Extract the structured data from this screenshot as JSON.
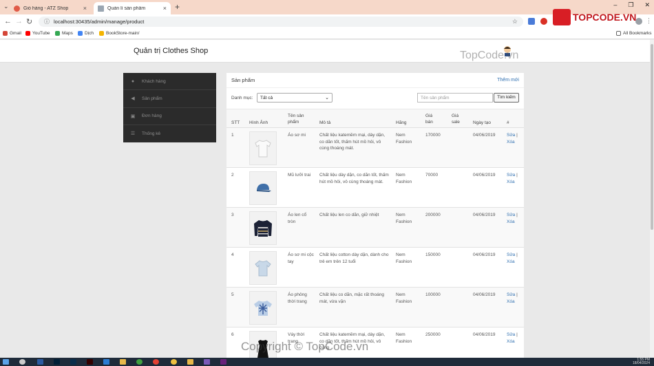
{
  "browser": {
    "tabs": [
      {
        "title": "Giỏ hàng - ATZ Shop",
        "color": "#e05a47",
        "active": false
      },
      {
        "title": "Quản lí sản phẩm",
        "color": "#9aa6b2",
        "active": true
      }
    ],
    "new_tab": "+",
    "url": "localhost:30435/admin/manage/product",
    "bookmarks": [
      {
        "label": "Gmail",
        "color": "#d44638"
      },
      {
        "label": "YouTube",
        "color": "#ff0000"
      },
      {
        "label": "Maps",
        "color": "#34a853"
      },
      {
        "label": "Dịch",
        "color": "#4285f4"
      },
      {
        "label": "BookStore-main/",
        "color": "#f4b400"
      }
    ],
    "all_bookmarks": "All Bookmarks"
  },
  "app": {
    "brand": "Quản trị Clothes Shop",
    "sidebar": [
      {
        "label": "Khách hàng",
        "icon": "user-icon"
      },
      {
        "label": "Sản phẩm",
        "icon": "megaphone-icon"
      },
      {
        "label": "Đơn hàng",
        "icon": "inbox-icon"
      },
      {
        "label": "Thống kê",
        "icon": "list-icon"
      }
    ],
    "panel_title": "Sản phẩm",
    "add_new": "Thêm mới",
    "filter_label": "Danh mục:",
    "filter_value": "Tất cả",
    "search_placeholder": "Tên sản phẩm",
    "search_button": "Tìm kiếm",
    "columns": {
      "stt": "STT",
      "image": "Hình Ảnh",
      "name": "Tên sản phẩm",
      "desc": "Mô tả",
      "brand": "Hãng",
      "price": "Giá bán",
      "sale": "Giá sale",
      "date": "Ngày tạo",
      "action": "#"
    },
    "rows": [
      {
        "stt": "1",
        "name": "Áo sơ mi",
        "desc": "Chất liệu katemềm mại, dày dặn, co dãn tốt, thấm hút mồ hôi, vô cùng thoáng mát.",
        "brand": "Nem Fashion",
        "price": "170000",
        "sale": "",
        "date": "04/06/2019",
        "img": "white-shirt",
        "edit": "Sửa",
        "sep": "|",
        "delete": "Xóa"
      },
      {
        "stt": "2",
        "name": "Mũ lưỡi trai",
        "desc": "Chất liệu dày dặn, co dãn tốt, thấm hút mồ hôi, vô cùng thoáng mát.",
        "brand": "Nem Fashion",
        "price": "70000",
        "sale": "",
        "date": "04/06/2019",
        "img": "blue-cap",
        "edit": "Sửa",
        "sep": "|",
        "delete": "Xóa"
      },
      {
        "stt": "3",
        "name": "Áo len cổ tròn",
        "desc": "Chất liệu len co dãn, giữ nhiệt",
        "brand": "Nem Fashion",
        "price": "200000",
        "sale": "",
        "date": "04/06/2019",
        "img": "striped-sweater",
        "edit": "Sửa",
        "sep": "|",
        "delete": "Xóa"
      },
      {
        "stt": "4",
        "name": "Áo sơ mi cộc tay",
        "desc": "Chất liệu cotton dày dặn, dành cho trẻ em trên 12 tuổi",
        "brand": "Nem Fashion",
        "price": "150000",
        "sale": "",
        "date": "04/06/2019",
        "img": "light-blue-shirt",
        "edit": "Sửa",
        "sep": "|",
        "delete": "Xóa"
      },
      {
        "stt": "5",
        "name": "Áo phông thời trang",
        "desc": "Chất liệu co dãn, mặc rất thoáng mát, vừa vặn",
        "brand": "Nem Fashion",
        "price": "100000",
        "sale": "",
        "date": "04/06/2019",
        "img": "tie-dye-tshirt",
        "edit": "Sửa",
        "sep": "|",
        "delete": "Xóa"
      },
      {
        "stt": "6",
        "name": "Váy thời trang",
        "desc": "Chất liệu katemềm mại, dày dặn, co dãn tốt, thấm hút mồ hôi, vô cùng",
        "brand": "Nem Fashion",
        "price": "250000",
        "sale": "",
        "date": "04/06/2019",
        "img": "black-dress",
        "edit": "Sửa",
        "sep": "|",
        "delete": "Xóa"
      }
    ]
  },
  "watermarks": {
    "logo": "TOPCODE.VN",
    "middle": "TopCode.vn",
    "copyright": "Copyright © TopCode.vn"
  },
  "taskbar": {
    "time": "1:55 PM",
    "date": "18/04/2024"
  },
  "colors": {
    "link": "#2f6fb0",
    "sidebar_bg": "#2b2b2b",
    "tab_strip": "#f6d8c9"
  }
}
